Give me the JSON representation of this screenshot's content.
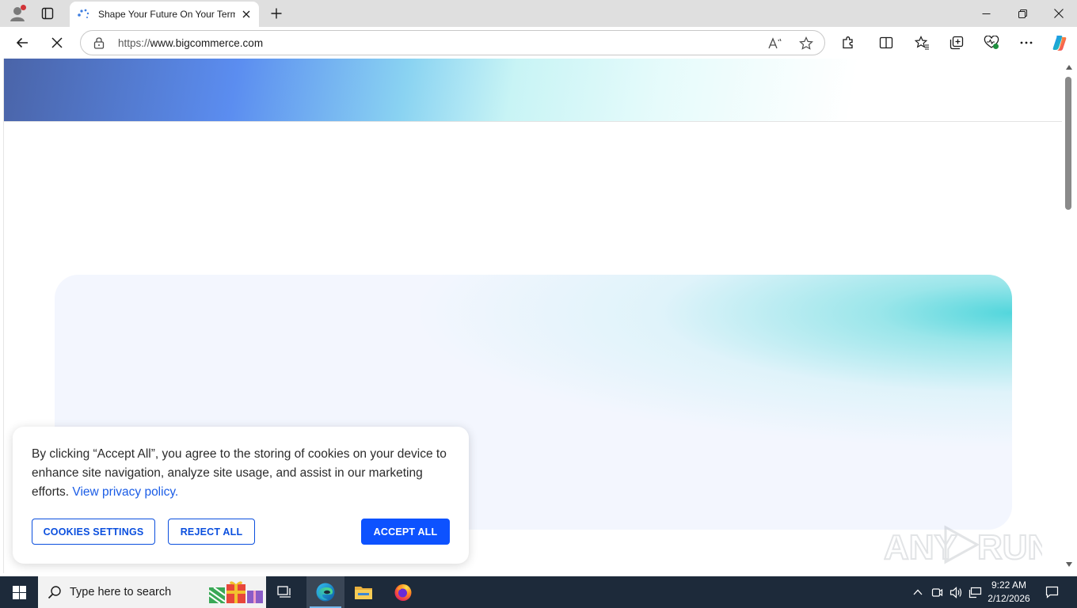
{
  "browser": {
    "tab_title": "Shape Your Future On Your Terms",
    "address_protocol": "https://",
    "address_domain": "www.bigcommerce.com"
  },
  "cookie_banner": {
    "message_before_link": "By clicking “Accept All”, you agree to the storing of cookies on your device to enhance site navigation, analyze site usage, and assist in our marketing efforts.",
    "privacy_link": "View privacy policy.",
    "settings_label": "COOKIES SETTINGS",
    "reject_label": "REJECT ALL",
    "accept_label": "ACCEPT ALL"
  },
  "watermark": {
    "text": "ANY RUN"
  },
  "taskbar": {
    "search_placeholder": "Type here to search",
    "time": "9:22 AM",
    "date": "2/12/2026"
  },
  "colors": {
    "accent_blue": "#0d52ff",
    "link_blue": "#1a5ce6",
    "taskbar_bg": "#1d2a3a"
  }
}
